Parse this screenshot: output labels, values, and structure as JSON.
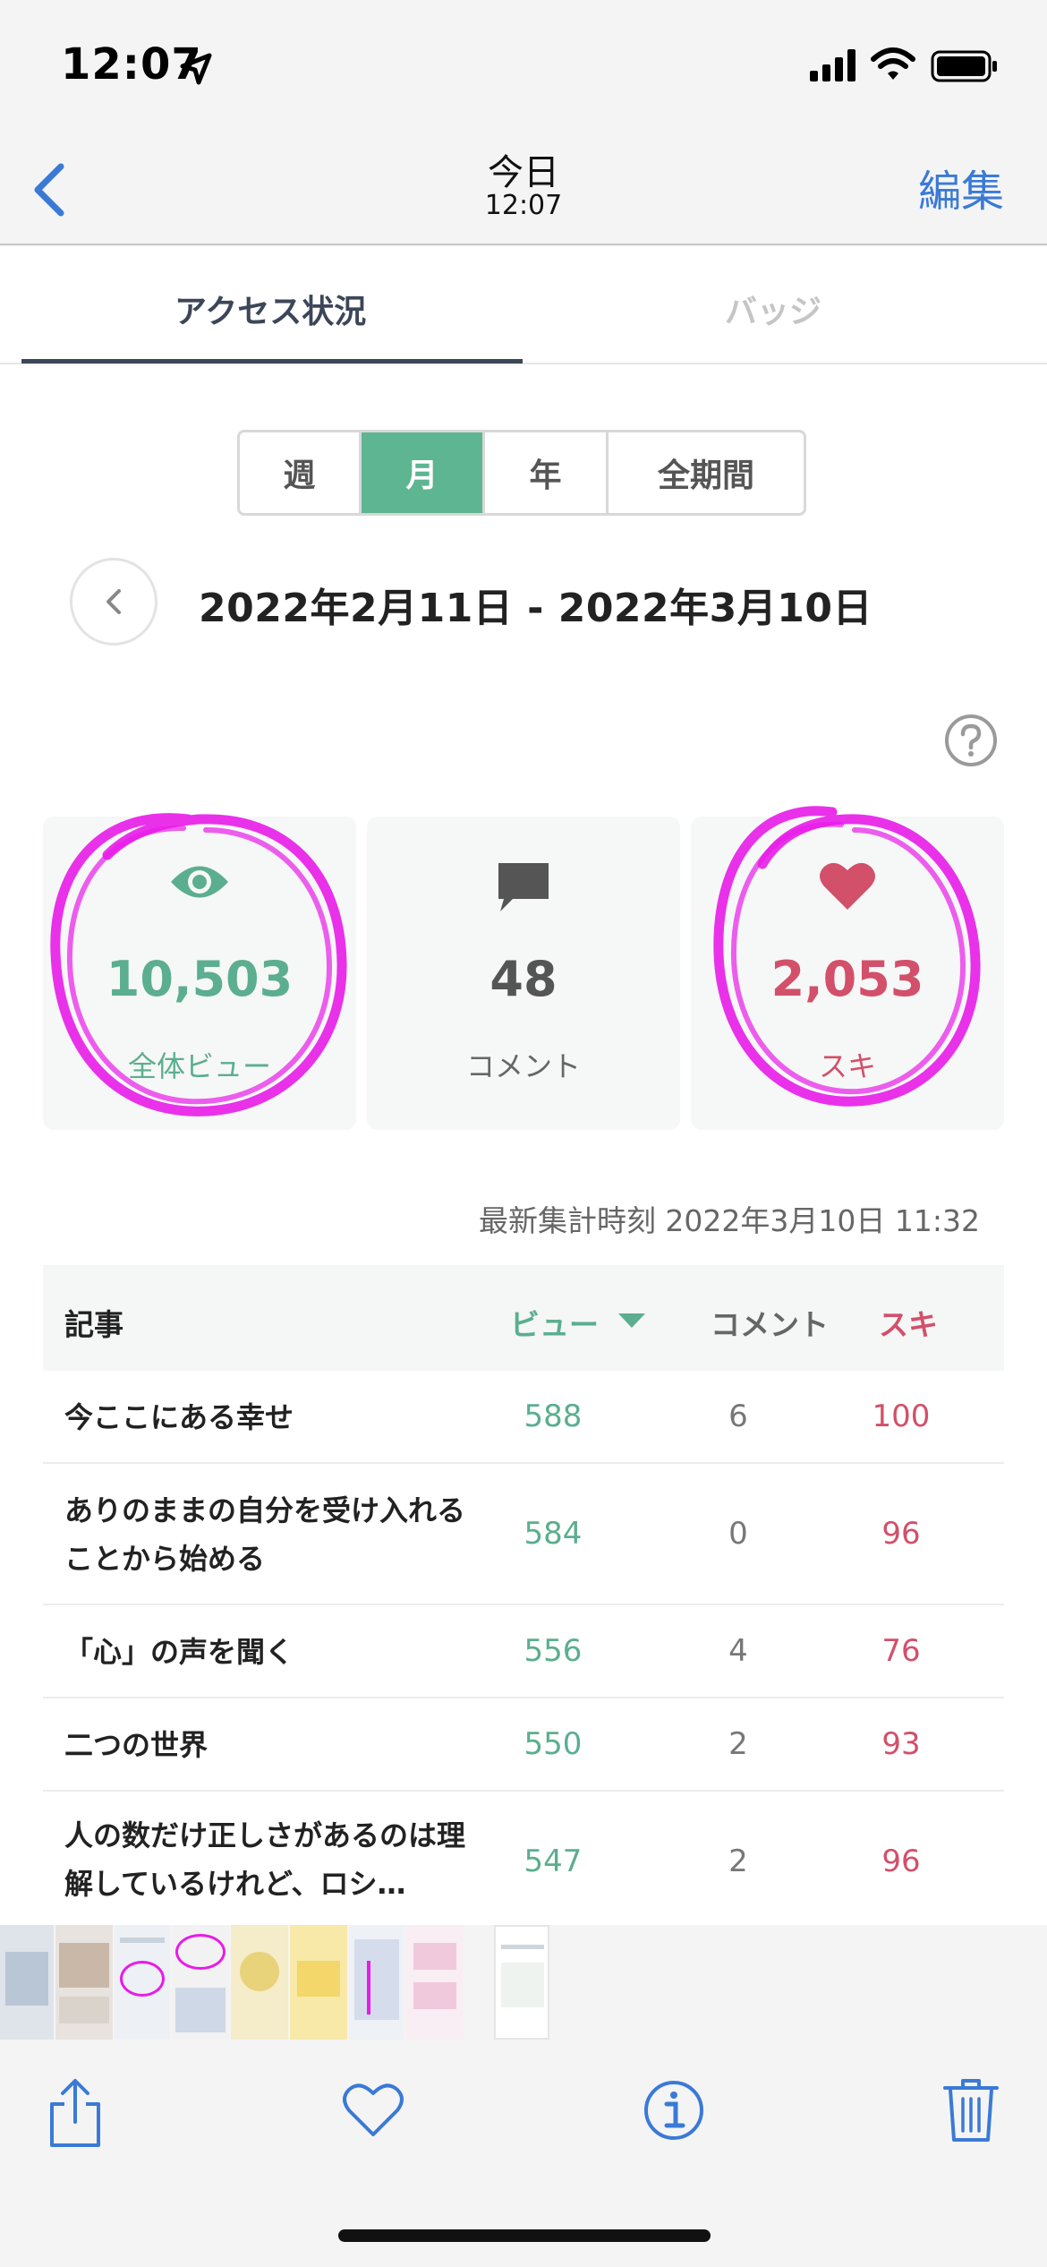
{
  "status_bar": {
    "time": "12:07"
  },
  "nav": {
    "title": "今日",
    "subtitle": "12:07",
    "edit_label": "編集"
  },
  "tabs": {
    "access": "アクセス状況",
    "badges": "バッジ"
  },
  "period_tabs": [
    "週",
    "月",
    "年",
    "全期間"
  ],
  "active_period": "月",
  "date_range": "2022年2月11日 - 2022年3月10日",
  "stats": {
    "views": {
      "value": "10,503",
      "label": "全体ビュー"
    },
    "comments": {
      "value": "48",
      "label": "コメント"
    },
    "likes": {
      "value": "2,053",
      "label": "スキ"
    }
  },
  "updated_at": "最新集計時刻 2022年3月10日 11:32",
  "table": {
    "headers": {
      "article": "記事",
      "views": "ビュー",
      "comments": "コメント",
      "likes": "スキ"
    },
    "rows": [
      {
        "title": "今ここにある幸せ",
        "views": "588",
        "comments": "6",
        "likes": "100"
      },
      {
        "title": "ありのままの自分を受け入れることから始める",
        "views": "584",
        "comments": "0",
        "likes": "96"
      },
      {
        "title": "「心」の声を聞く",
        "views": "556",
        "comments": "4",
        "likes": "76"
      },
      {
        "title": "二つの世界",
        "views": "550",
        "comments": "2",
        "likes": "93"
      },
      {
        "title": "人の数だけ正しさがあるのは理解しているけれど、ロシ…",
        "views": "547",
        "comments": "2",
        "likes": "96"
      }
    ]
  },
  "colors": {
    "accent_green": "#5db592",
    "accent_red": "#d2506a",
    "link_blue": "#3a7ad6",
    "annotation_magenta": "#e81be8"
  },
  "toolbar_icons": [
    "share-icon",
    "heart-icon",
    "info-icon",
    "trash-icon"
  ]
}
